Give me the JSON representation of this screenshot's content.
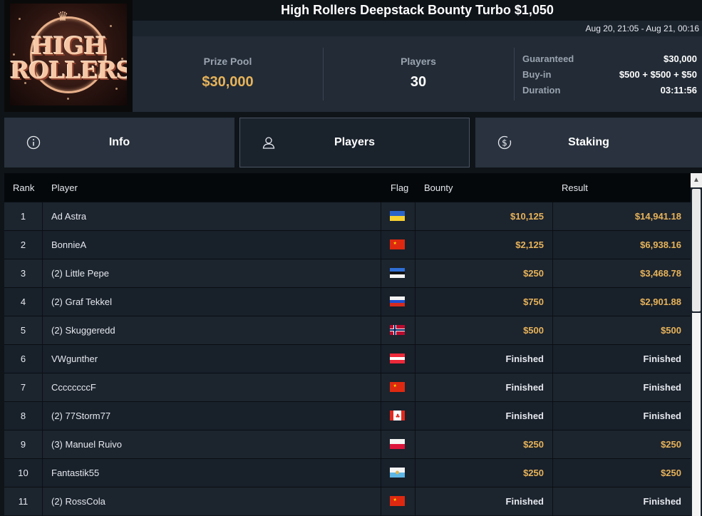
{
  "logo": {
    "line1": "HIGH",
    "line2": "ROLLERS"
  },
  "tournament": {
    "title": "High Rollers Deepstack Bounty Turbo $1,050",
    "dates": "Aug 20, 21:05 - Aug 21, 00:16"
  },
  "stats": {
    "prize_pool_label": "Prize Pool",
    "prize_pool_value": "$30,000",
    "players_label": "Players",
    "players_value": "30",
    "guaranteed_label": "Guaranteed",
    "guaranteed_value": "$30,000",
    "buyin_label": "Buy-in",
    "buyin_value": "$500 + $500 + $50",
    "duration_label": "Duration",
    "duration_value": "03:11:56"
  },
  "tabs": [
    {
      "label": "Info",
      "icon": "info-icon",
      "active": false
    },
    {
      "label": "Players",
      "icon": "user-icon",
      "active": true
    },
    {
      "label": "Staking",
      "icon": "dollar-coin-icon",
      "active": false
    }
  ],
  "table": {
    "headers": {
      "rank": "Rank",
      "player": "Player",
      "flag": "Flag",
      "bounty": "Bounty",
      "result": "Result"
    },
    "rows": [
      {
        "rank": "1",
        "player": "Ad Astra",
        "flag": "ukraine-flag-icon",
        "bounty": "$10,125",
        "result": "$14,941.18"
      },
      {
        "rank": "2",
        "player": "BonnieA",
        "flag": "china-flag-icon",
        "bounty": "$2,125",
        "result": "$6,938.16"
      },
      {
        "rank": "3",
        "player": "(2) Little Pepe",
        "flag": "estonia-flag-icon",
        "bounty": "$250",
        "result": "$3,468.78"
      },
      {
        "rank": "4",
        "player": "(2) Graf Tekkel",
        "flag": "russia-flag-icon",
        "bounty": "$750",
        "result": "$2,901.88"
      },
      {
        "rank": "5",
        "player": "(2) Skuggeredd",
        "flag": "norway-flag-icon",
        "bounty": "$500",
        "result": "$500"
      },
      {
        "rank": "6",
        "player": "VWgunther",
        "flag": "austria-flag-icon",
        "bounty": "Finished",
        "result": "Finished"
      },
      {
        "rank": "7",
        "player": "CcccccccF",
        "flag": "china-flag-icon",
        "bounty": "Finished",
        "result": "Finished"
      },
      {
        "rank": "8",
        "player": "(2) 77Storm77",
        "flag": "canada-flag-icon",
        "bounty": "Finished",
        "result": "Finished"
      },
      {
        "rank": "9",
        "player": "(3) Manuel Ruivo",
        "flag": "poland-flag-icon",
        "bounty": "$250",
        "result": "$250"
      },
      {
        "rank": "10",
        "player": "Fantastik55",
        "flag": "san-marino-flag-icon",
        "bounty": "$250",
        "result": "$250"
      },
      {
        "rank": "11",
        "player": "(2) RossCola",
        "flag": "china-flag-icon",
        "bounty": "Finished",
        "result": "Finished"
      }
    ]
  },
  "colors": {
    "money": "#e7b35a",
    "finished": "#e6e9ee"
  }
}
